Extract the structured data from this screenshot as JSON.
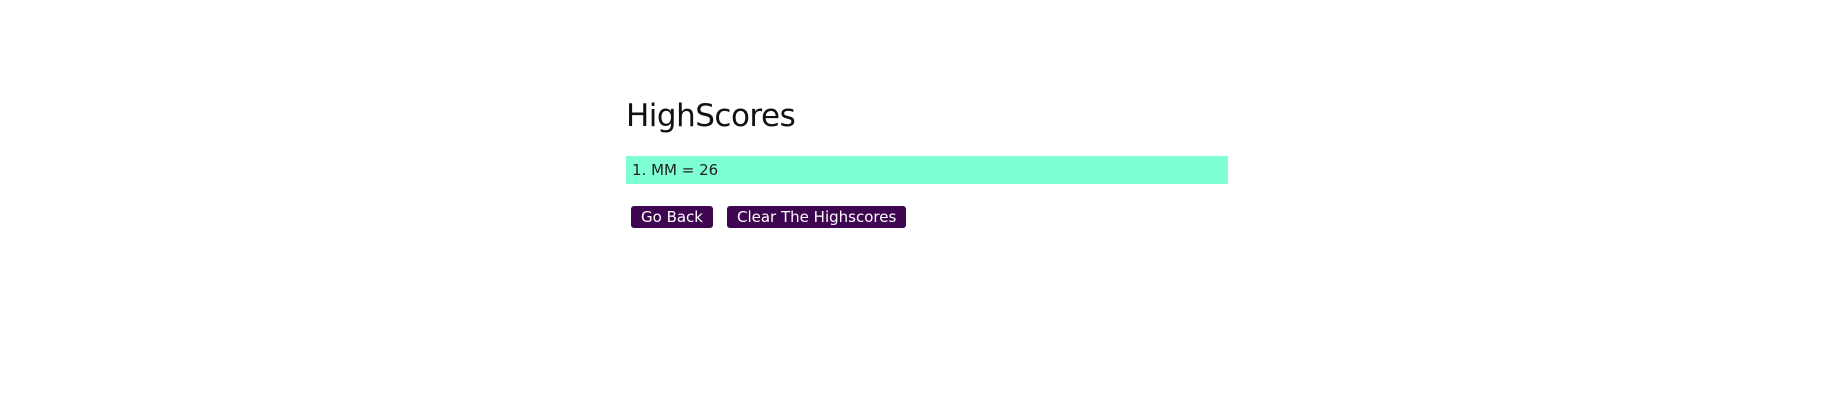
{
  "page": {
    "title": "HighScores"
  },
  "scores": [
    {
      "text": "1. MM = 26"
    }
  ],
  "buttons": {
    "go_back_label": "Go Back",
    "clear_label": "Clear The Highscores"
  },
  "colors": {
    "score_row_background": "#7fffd4",
    "button_background": "#3e0650",
    "button_text": "#ffffff"
  }
}
